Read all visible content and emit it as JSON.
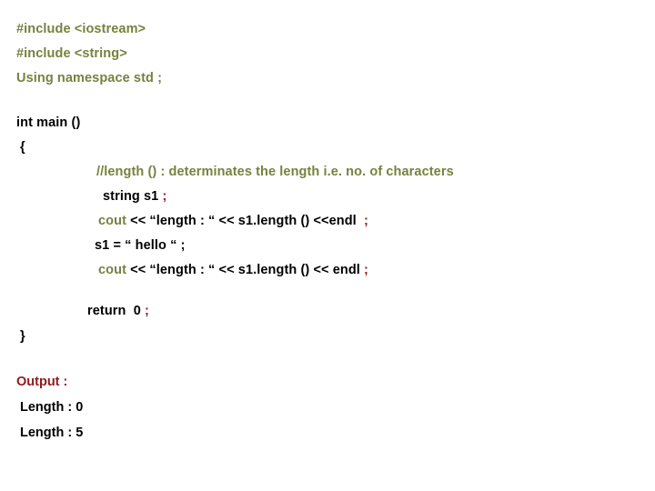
{
  "slide": {
    "background_color": "#ffffff",
    "colors": {
      "keyword_olive": "#78813F",
      "code_black": "#000000",
      "accent_red": "#8E1B1B"
    }
  },
  "code": {
    "includes": [
      {
        "text": "#include <iostream>",
        "color": "olive"
      },
      {
        "text": "#include <string>",
        "color": "olive"
      },
      {
        "text": "Using namespace std ;",
        "color": "olive"
      }
    ],
    "signature": [
      {
        "text": "int main ()",
        "color": "black"
      },
      {
        "text": "{",
        "color": "black"
      }
    ],
    "comment": "//length () : determinates the length i.e. no. of characters",
    "statements": {
      "declare": {
        "code": "string s1 ",
        "terminator": ";"
      },
      "cout_1": {
        "keyword": "cout",
        "rest": " << “length : “ << s1.length () <<endl  ",
        "terminator": ";"
      },
      "assign": {
        "code": "s1 = “ hello “ ;"
      },
      "cout_2": {
        "keyword": "cout",
        "rest": " << “length : “ << s1.length () << endl ",
        "terminator": ";"
      }
    },
    "return_statement": {
      "code": "return  0 ",
      "terminator": ";"
    },
    "closing_brace": "}"
  },
  "output": {
    "heading": "Output :",
    "lines": [
      "Length : 0",
      "Length : 5"
    ]
  }
}
